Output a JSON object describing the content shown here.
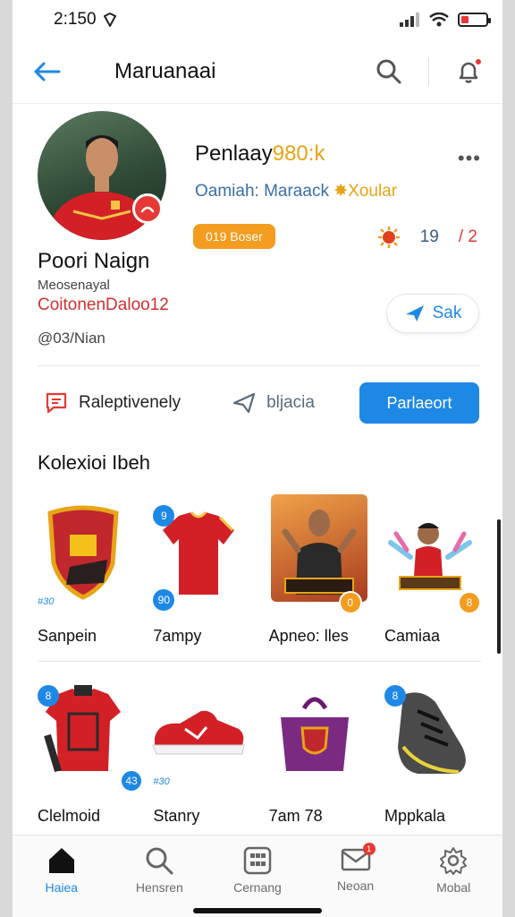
{
  "status": {
    "time": "2:150"
  },
  "header": {
    "title": "Maruanaai"
  },
  "profile": {
    "name_main": "Penlaay",
    "name_accent": "980:k",
    "subtitle_main": "Oamiah: Maraack",
    "subtitle_accent": "Xoular",
    "badge": "019 Boser",
    "stat_value": "19",
    "stat_extra": "/ 2",
    "user_name": "Poori Naign",
    "user_category": "Meosenayal",
    "user_team": "CoitonenDaloo12",
    "user_handle": "@03/Nian",
    "sak_label": "Sak"
  },
  "actions": {
    "first_label": "Raleptivenely",
    "second_label": "bljacia",
    "primary_label": "Parlaeort"
  },
  "collection": {
    "title": "Kolexioi Ibeh",
    "items": [
      {
        "label": "Sanpein",
        "tag": "#30"
      },
      {
        "label": "7ampy",
        "tl": "9",
        "bl": "90"
      },
      {
        "label": "Apneo: lles",
        "br": "0"
      },
      {
        "label": "Camiaa",
        "br": "8"
      },
      {
        "label": "Clelmoid",
        "tl": "8",
        "br": "43"
      },
      {
        "label": "Stanry",
        "tag": "#30"
      },
      {
        "label": "7am 78"
      },
      {
        "label": "Mppkala",
        "tl": "8"
      }
    ]
  },
  "nav": {
    "items": [
      {
        "label": "Haiea"
      },
      {
        "label": "Hensren"
      },
      {
        "label": "Cernang"
      },
      {
        "label": "Neoan",
        "badge": "1"
      },
      {
        "label": "Mobal"
      }
    ]
  },
  "colors": {
    "accent": "#1e88e5",
    "brand_red": "#e53935",
    "gold": "#f39c1f"
  }
}
